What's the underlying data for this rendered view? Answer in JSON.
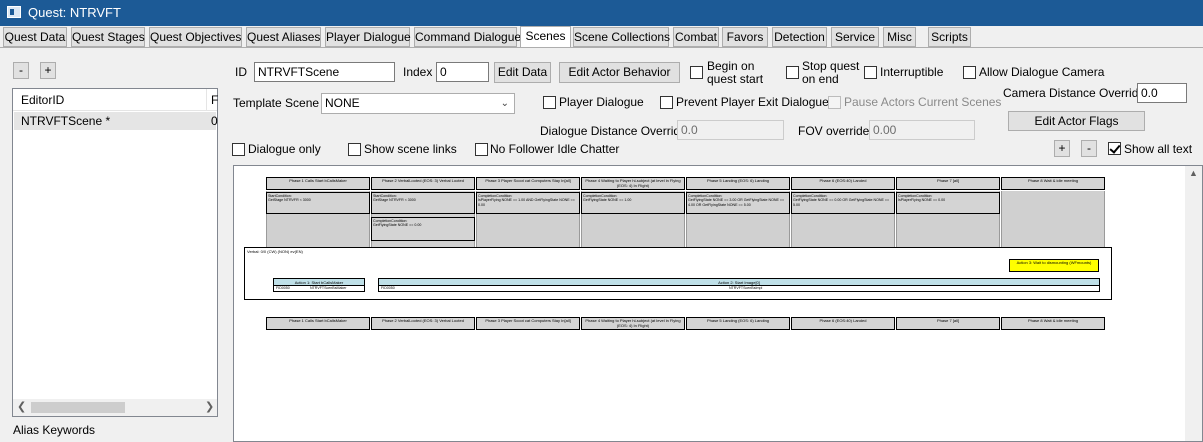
{
  "window": {
    "title": "Quest: NTRVFT"
  },
  "tabs": [
    {
      "label": "Quest Data"
    },
    {
      "label": "Quest Stages"
    },
    {
      "label": "Quest Objectives"
    },
    {
      "label": "Quest Aliases"
    },
    {
      "label": "Player Dialogue"
    },
    {
      "label": "Command Dialogue"
    },
    {
      "label": "Scenes",
      "active": true
    },
    {
      "label": "Scene Collections"
    },
    {
      "label": "Combat"
    },
    {
      "label": "Favors"
    },
    {
      "label": "Detection"
    },
    {
      "label": "Service"
    },
    {
      "label": "Misc"
    },
    {
      "label": "Scripts"
    }
  ],
  "left": {
    "minus_label": "-",
    "plus_label": "+",
    "col_editor_id": "EditorID",
    "col_f": "F",
    "rows": [
      {
        "editor_id": "NTRVFTScene *",
        "f": "0"
      }
    ],
    "alias_keywords_label": "Alias Keywords"
  },
  "scene": {
    "id_label": "ID",
    "id_value": "NTRVFTScene",
    "index_label": "Index",
    "index_value": "0",
    "edit_data_label": "Edit Data",
    "edit_actor_behavior_label": "Edit Actor Behavior",
    "begin_on_quest_start_label": "Begin on\nquest start",
    "stop_quest_on_end_label": "Stop quest\non end",
    "interruptible_label": "Interruptible",
    "allow_dialogue_camera_label": "Allow Dialogue Camera",
    "template_scene_label": "Template Scene",
    "template_scene_value": "NONE",
    "player_dialogue_label": "Player Dialogue",
    "prevent_player_exit_dialogue_label": "Prevent Player Exit Dialogue",
    "pause_actors_label": "Pause Actors Current Scenes",
    "camera_distance_override_label": "Camera Distance Override",
    "camera_distance_override_value": "0.0",
    "dialogue_distance_override_label": "Dialogue Distance Override",
    "dialogue_distance_override_value": "0.0",
    "fov_override_label": "FOV override",
    "fov_override_value": "0.00",
    "edit_actor_flags_label": "Edit Actor Flags",
    "dialogue_only_label": "Dialogue only",
    "show_scene_links_label": "Show scene links",
    "no_follower_idle_chatter_label": "No Follower Idle Chatter",
    "zoom_plus_label": "+",
    "zoom_minus_label": "-",
    "show_all_text_label": "Show all text",
    "show_all_text_checked": true
  },
  "canvas": {
    "phase_headers": [
      "Phase 1 Calls Start bCallsMaker",
      "Phase 2 VerbalLooted (EOS: 3) Verbal Looted",
      "Phase 3 Player Scoot cat Computers Stay In[all]",
      "Phase 4 Waiting to Player hi-subject (at level in Flying (EOS: 4) In Flight)",
      "Phase 5 Landing (EOS: 6) Landing",
      "Phase 6 (EOS:40) Landed",
      "Phase 7 [all]",
      "Phase 8 Wait & idle meeting"
    ],
    "phase_conditions": [
      "StartCondition:\nGetStage NTRVFR < 3000",
      "StartCondition:\nGetStage NTRVFR < 3000",
      "CompletionCondition:\nIsPlayerFlying NONE == 1.00 AND GetFlyingState NONE == 0.00",
      "CompletionCondition:\nGetFlyingState NONE == 1.00",
      "CompletionCondition:\nGetFlyingState NONE == 3.00 OR GetFlyingState NONE == 4.00 OR GetFlyingState NONE == 5.00",
      "CompletionCondition:\nGetFlyingState NONE == 0.00 OR GetFlyingState NONE == 5.00",
      "CompletionCondition:\nIsPlayerFlying NONE == 0.00"
    ],
    "phase2_extra": "CompletionCondition:\nGetFlyingState NONE == 0.00",
    "verbal_line": "Verbal: 0/0 (CW) (NON) ev(EN)",
    "yellow_action": "Action 3: Wait to dismounting (WFmounts)",
    "action1_header": "Action 1: Start bCallsMaker",
    "action1_row_id": "FID0050",
    "action1_row_name": "NTRVFTScenBsMaker",
    "action2_header": "Action 2: Start Image[0]",
    "action2_row_id": "FID0050",
    "action2_row_name": "NTRVFTScenBsImpl"
  },
  "colors": {
    "titlebar": "#1c5a96",
    "phase_fill": "#d4d4d4",
    "action_header": "#bfe0e8",
    "yellow_action": "#ffff00"
  }
}
